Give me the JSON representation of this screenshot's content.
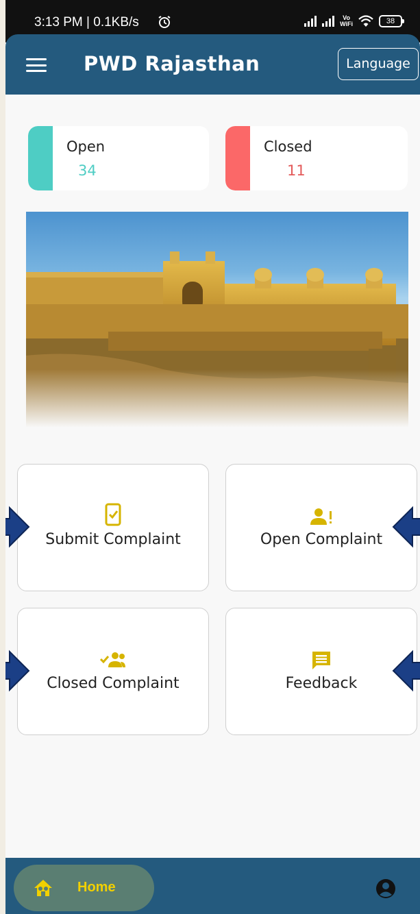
{
  "status_bar": {
    "time": "3:13 PM | 0.1KB/s",
    "vowifi_top": "Vo",
    "vowifi_bottom": "WiFi",
    "battery": "38"
  },
  "app_bar": {
    "title": "PWD Rajasthan",
    "language_button": "Language"
  },
  "stats": {
    "open": {
      "label": "Open",
      "count": "34",
      "color": "#4ecdc4"
    },
    "closed": {
      "label": "Closed",
      "count": "11",
      "color": "#fb6868"
    }
  },
  "tiles": [
    {
      "label": "Submit Complaint",
      "icon": "mobile-check-icon"
    },
    {
      "label": "Open Complaint",
      "icon": "person-alert-icon"
    },
    {
      "label": "Closed Complaint",
      "icon": "group-check-icon"
    },
    {
      "label": "Feedback",
      "icon": "message-icon"
    }
  ],
  "bottom_nav": {
    "home_label": "Home",
    "home_icon": "home-icon",
    "profile_icon": "account-circle-icon"
  },
  "colors": {
    "primary": "#245a7e",
    "accent_yellow": "#e0c000",
    "open": "#4ecdc4",
    "closed": "#fb6868",
    "arrow": "#1b3f86"
  }
}
